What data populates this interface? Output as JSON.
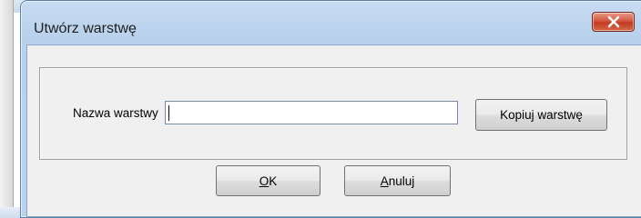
{
  "dialog": {
    "title": "Utwórz warstwę",
    "close_label": "close"
  },
  "form": {
    "name_label": "Nazwa warstwy",
    "name_value": "",
    "copy_button_label": "Kopiuj warstwę"
  },
  "buttons": {
    "ok_mnemonic": "O",
    "ok_rest": "K",
    "cancel_mnemonic": "A",
    "cancel_rest": "nuluj"
  },
  "colors": {
    "title_bar": "#bcd2ec",
    "close_button": "#c33a21",
    "client_area": "#f0f0f0"
  }
}
